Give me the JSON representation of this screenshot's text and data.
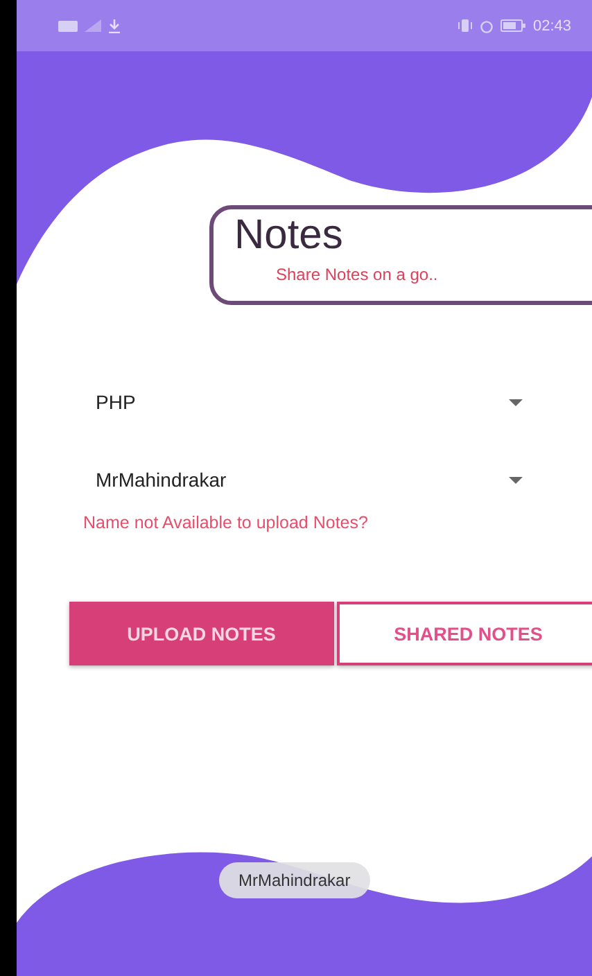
{
  "status_bar": {
    "time": "02:43"
  },
  "header": {
    "title": "Notes",
    "subtitle": "Share Notes on a go.."
  },
  "dropdowns": [
    {
      "value": "PHP"
    },
    {
      "value": "MrMahindrakar"
    }
  ],
  "error_text": "Name not Available to upload Notes?",
  "buttons": [
    {
      "label": "UPLOAD NOTES",
      "selected": true
    },
    {
      "label": "SHARED NOTES",
      "selected": false
    }
  ],
  "toast": "MrMahindrakar"
}
